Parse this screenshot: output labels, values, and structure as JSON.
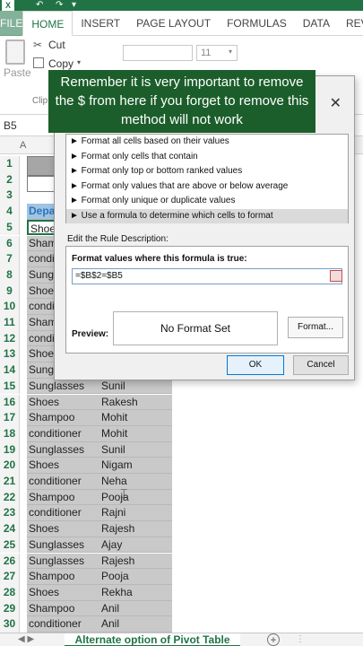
{
  "quick_access": {
    "app_icon": "excel-logo",
    "logo_text": "X",
    "undo_icon": "undo-icon",
    "undo_glyph": "↶",
    "redo_icon": "redo-icon",
    "redo_glyph": "↷",
    "more_glyph": "▾"
  },
  "ribbon": {
    "tabs": [
      "FILE",
      "HOME",
      "INSERT",
      "PAGE LAYOUT",
      "FORMULAS",
      "DATA",
      "REV"
    ],
    "active_tab": "HOME",
    "clipboard": {
      "paste_label": "Paste",
      "cut_label": "Cut",
      "cut_glyph": "✂",
      "copy_label": "Copy",
      "copy_dropdown": "▾",
      "group_label": "Clip"
    },
    "font": {
      "font_size": "11",
      "dropdown": "▾"
    }
  },
  "formula_bar": {
    "name_box": "B5"
  },
  "sheet": {
    "column_a_header": "A",
    "rows": [
      {
        "num": "1",
        "b": "",
        "c": ""
      },
      {
        "num": "2",
        "b": "",
        "c": ""
      },
      {
        "num": "3",
        "b": "",
        "c": ""
      },
      {
        "num": "4",
        "b": "Depa",
        "c": ""
      },
      {
        "num": "5",
        "b": "Shoes",
        "c": ""
      },
      {
        "num": "6",
        "b": "Shamp",
        "c": ""
      },
      {
        "num": "7",
        "b": "condit",
        "c": ""
      },
      {
        "num": "8",
        "b": "Sungla",
        "c": ""
      },
      {
        "num": "9",
        "b": "Shoes",
        "c": ""
      },
      {
        "num": "10",
        "b": "condit",
        "c": ""
      },
      {
        "num": "11",
        "b": "Shamp",
        "c": ""
      },
      {
        "num": "12",
        "b": "condit",
        "c": ""
      },
      {
        "num": "13",
        "b": "Shoes",
        "c": ""
      },
      {
        "num": "14",
        "b": "Sungla",
        "c": ""
      },
      {
        "num": "15",
        "b": "Sunglasses",
        "c": "Sunil"
      },
      {
        "num": "16",
        "b": "Shoes",
        "c": "Rakesh"
      },
      {
        "num": "17",
        "b": "Shampoo",
        "c": "Mohit"
      },
      {
        "num": "18",
        "b": "conditioner",
        "c": "Mohit"
      },
      {
        "num": "19",
        "b": "Sunglasses",
        "c": "Sunil"
      },
      {
        "num": "20",
        "b": "Shoes",
        "c": "Nigam"
      },
      {
        "num": "21",
        "b": "conditioner",
        "c": "Neha"
      },
      {
        "num": "22",
        "b": "Shampoo",
        "c": "Pooja"
      },
      {
        "num": "23",
        "b": "conditioner",
        "c": "Rajni"
      },
      {
        "num": "24",
        "b": "Shoes",
        "c": "Rajesh"
      },
      {
        "num": "25",
        "b": "Sunglasses",
        "c": "Ajay"
      },
      {
        "num": "26",
        "b": "Sunglasses",
        "c": "Rajesh"
      },
      {
        "num": "27",
        "b": "Shampoo",
        "c": "Pooja"
      },
      {
        "num": "28",
        "b": "Shoes",
        "c": "Rekha"
      },
      {
        "num": "29",
        "b": "Shampoo",
        "c": "Anil"
      },
      {
        "num": "30",
        "b": "conditioner",
        "c": "Anil"
      }
    ]
  },
  "sheet_tabs": {
    "nav_glyph": "◀  ▶",
    "active_tab": "Alternate option of Pivot Table",
    "add_glyph": "+",
    "scroll_glyph": "⋮"
  },
  "dialog": {
    "close_glyph": "✕",
    "rule_types": [
      "► Format all cells based on their values",
      "► Format only cells that contain",
      "► Format only top or bottom ranked values",
      "► Format only values that are above or below average",
      "► Format only unique or duplicate values",
      "► Use a formula to determine which cells to format"
    ],
    "selected_rule_index": 5,
    "edit_rule_label": "Edit the Rule Description:",
    "formula_label": "Format values where this formula is true:",
    "formula_value": "=$B$2=$B5",
    "preview_label": "Preview:",
    "preview_text": "No Format Set",
    "format_button": "Format...",
    "ok_button": "OK",
    "cancel_button": "Cancel",
    "cursor_glyph": "⌶"
  },
  "caption": {
    "text": "Remember it is very important to remove the $ from here if you forget to remove this method will not work"
  },
  "colors": {
    "excel_green": "#217346",
    "caption_bg": "#1c5e2b",
    "header_fill": "#9fc4e6",
    "selection_gray": "#c9c9c9"
  }
}
